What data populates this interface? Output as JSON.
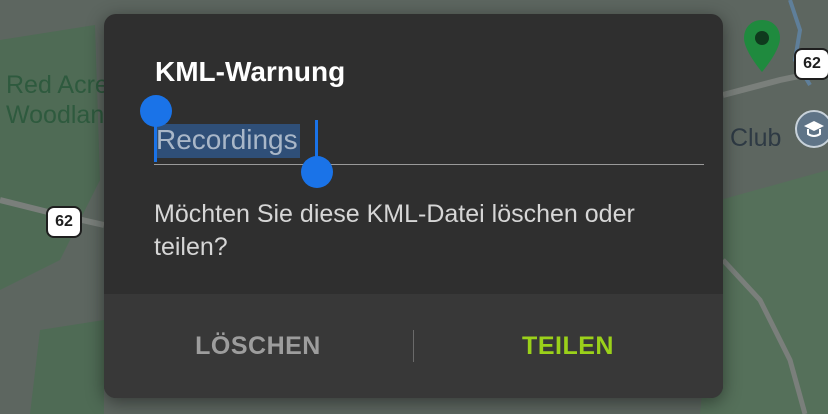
{
  "map": {
    "labels": {
      "area1_line1": "Red Acre",
      "area1_line2": "Woodland",
      "route_left": "62",
      "route_right": "62",
      "club": "Club"
    },
    "colors": {
      "background": "#5d6660",
      "park": "#4f6b55",
      "road": "#7a7f7b",
      "pin": "#1f8a3e"
    }
  },
  "dialog": {
    "title": "KML-Warnung",
    "filename_value": "Recordings",
    "message": "Möchten Sie diese KML-Datei löschen oder teilen?",
    "buttons": {
      "delete_label": "LÖSCHEN",
      "share_label": "TEILEN"
    },
    "colors": {
      "background": "#2f2f2f",
      "accent": "#9bd11a",
      "selection": "#1a73e8"
    }
  }
}
